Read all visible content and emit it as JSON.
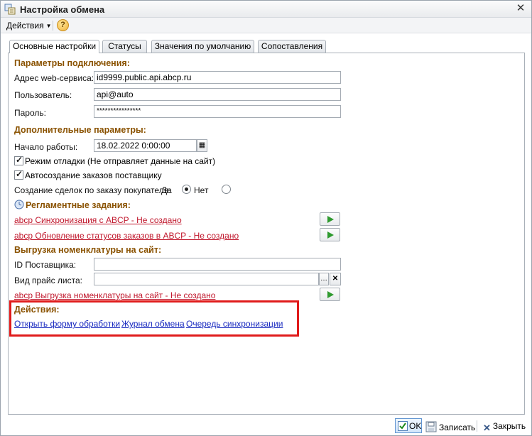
{
  "window": {
    "title": "Настройка обмена"
  },
  "menu": {
    "actions_label": "Действия",
    "help_label": "?"
  },
  "tabs": [
    {
      "label": "Основные настройки",
      "active": true
    },
    {
      "label": "Статусы",
      "active": false
    },
    {
      "label": "Значения по умолчанию",
      "active": false
    },
    {
      "label": "Сопоставления",
      "active": false
    }
  ],
  "connection": {
    "header": "Параметры подключения:",
    "address_label": "Адрес web-сервиса:",
    "address_value": "id9999.public.api.abcp.ru",
    "user_label": "Пользователь:",
    "user_value": "api@auto",
    "password_label": "Пароль:",
    "password_value": "****************"
  },
  "extra": {
    "header": "Дополнительные параметры:",
    "start_label": "Начало работы:",
    "start_value": "18.02.2022  0:00:00",
    "debug_label": "Режим отладки (Не отправляет данные на сайт)",
    "debug_checked": true,
    "autocreate_label": "Автосоздание заказов поставщику",
    "autocreate_checked": true,
    "deals_label": "Создание сделок по заказу покупателя:",
    "yes_label": "Да",
    "no_label": "Нет",
    "deals_selected": "yes"
  },
  "scheduled": {
    "header": "Регламентные задания:",
    "task1": "abcp  Синхронизация с ABCP - Не создано",
    "task2": "abcp  Обновление статусов заказов в ABCP - Не создано"
  },
  "export": {
    "header": "Выгрузка номенклатуры на сайт:",
    "supplier_label": "ID Поставщика:",
    "supplier_value": "",
    "pricelist_label": "Вид прайс листа:",
    "pricelist_value": "",
    "task": "abcp  Выгрузка номенклатуры на сайт - Не создано"
  },
  "actions": {
    "header": "Действия:",
    "open_form": "Открыть форму обработки",
    "log": "Журнал обмена",
    "queue": "Очередь синхронизации"
  },
  "footer": {
    "ok": "OK",
    "save": "Записать",
    "close": "Закрыть"
  },
  "colors": {
    "section_header": "#8a5200",
    "link_red": "#c0162b",
    "link_blue": "#1a2bc0",
    "highlight": "#e01b1b",
    "run_arrow": "#2f9a2f"
  }
}
